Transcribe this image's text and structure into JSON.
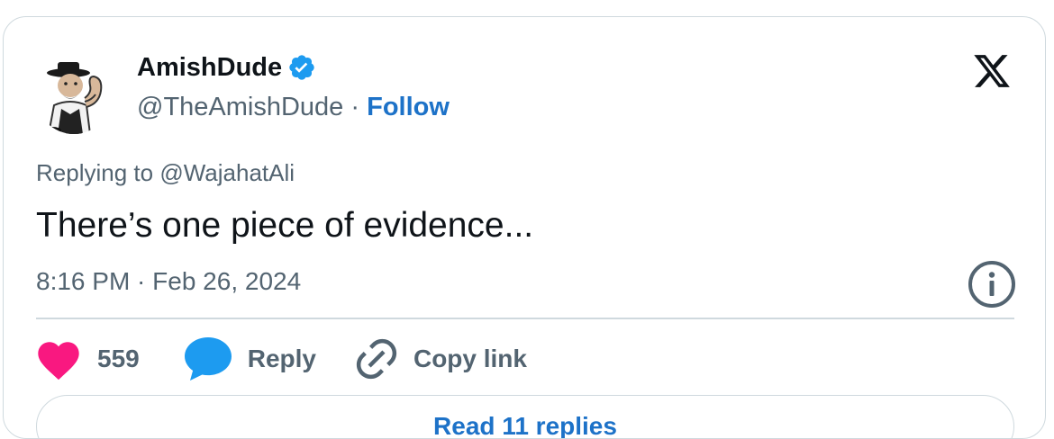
{
  "author": {
    "display_name": "AmishDude",
    "handle": "@TheAmishDude",
    "separator": "·",
    "follow_label": "Follow",
    "verified": true
  },
  "reply_context": {
    "prefix": "Replying to",
    "mention": "@WajahatAli"
  },
  "tweet": {
    "text": "There’s one piece of evidence...",
    "timestamp": "8:16 PM · Feb 26, 2024"
  },
  "actions": {
    "like_count": "559",
    "reply_label": "Reply",
    "copy_link_label": "Copy link"
  },
  "read_replies_label": "Read 11 replies",
  "icons": {
    "brand": "x-logo-icon",
    "verified": "verified-badge-icon",
    "info": "info-icon",
    "like": "heart-icon",
    "reply": "speech-bubble-icon",
    "copy": "link-icon"
  },
  "colors": {
    "like": "#f91880",
    "reply": "#1d9bf0",
    "follow_link": "#1d72c8",
    "secondary_text": "#536471",
    "border": "#cfd9de"
  }
}
